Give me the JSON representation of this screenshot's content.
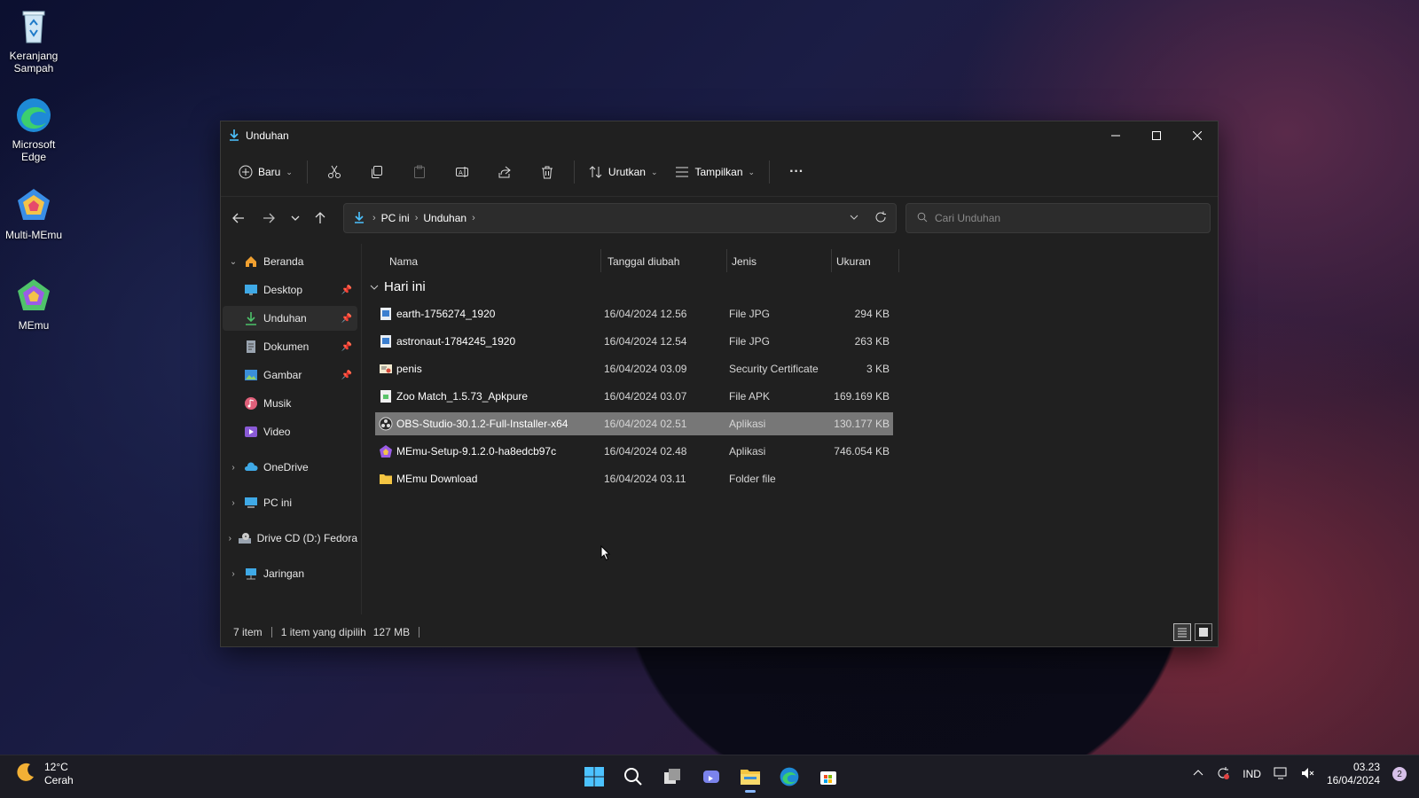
{
  "desktop": {
    "icons": [
      {
        "label": "Keranjang Sampah",
        "icon": "recycle-bin-icon"
      },
      {
        "label": "Microsoft Edge",
        "icon": "edge-icon"
      },
      {
        "label": "Multi-MEmu",
        "icon": "multi-memu-icon"
      },
      {
        "label": "MEmu",
        "icon": "memu-icon"
      }
    ]
  },
  "window": {
    "title": "Unduhan",
    "toolbar": {
      "new_label": "Baru",
      "sort_label": "Urutkan",
      "view_label": "Tampilkan",
      "more_label": "···"
    },
    "address": {
      "crumbs": [
        "PC ini",
        "Unduhan"
      ]
    },
    "search": {
      "placeholder": "Cari Unduhan"
    },
    "sidebar": {
      "items": [
        {
          "label": "Beranda",
          "icon": "home-icon"
        },
        {
          "label": "Desktop",
          "icon": "desktop-icon"
        },
        {
          "label": "Unduhan",
          "icon": "download-icon"
        },
        {
          "label": "Dokumen",
          "icon": "document-icon"
        },
        {
          "label": "Gambar",
          "icon": "picture-icon"
        },
        {
          "label": "Musik",
          "icon": "music-icon"
        },
        {
          "label": "Video",
          "icon": "video-icon"
        },
        {
          "label": "OneDrive",
          "icon": "cloud-icon"
        },
        {
          "label": "PC ini",
          "icon": "pc-icon"
        },
        {
          "label": "Drive CD (D:) Fedora",
          "icon": "cd-drive-icon"
        },
        {
          "label": "Jaringan",
          "icon": "network-icon"
        }
      ]
    },
    "columns": {
      "name": "Nama",
      "date": "Tanggal diubah",
      "type": "Jenis",
      "size": "Ukuran"
    },
    "group": "Hari ini",
    "files": [
      {
        "name": "earth-1756274_1920",
        "date": "16/04/2024 12.56",
        "type": "File JPG",
        "size": "294 KB",
        "icon": "image-file-icon"
      },
      {
        "name": "astronaut-1784245_1920",
        "date": "16/04/2024 12.54",
        "type": "File JPG",
        "size": "263 KB",
        "icon": "image-file-icon"
      },
      {
        "name": "penis",
        "date": "16/04/2024 03.09",
        "type": "Security Certificate",
        "size": "3 KB",
        "icon": "certificate-icon"
      },
      {
        "name": "Zoo Match_1.5.73_Apkpure",
        "date": "16/04/2024 03.07",
        "type": "File APK",
        "size": "169.169 KB",
        "icon": "apk-file-icon"
      },
      {
        "name": "OBS-Studio-30.1.2-Full-Installer-x64",
        "date": "16/04/2024 02.51",
        "type": "Aplikasi",
        "size": "130.177 KB",
        "icon": "obs-icon"
      },
      {
        "name": "MEmu-Setup-9.1.2.0-ha8edcb97c",
        "date": "16/04/2024 02.48",
        "type": "Aplikasi",
        "size": "746.054 KB",
        "icon": "memu-setup-icon"
      },
      {
        "name": "MEmu Download",
        "date": "16/04/2024 03.11",
        "type": "Folder file",
        "size": "",
        "icon": "folder-icon"
      }
    ],
    "status": {
      "count": "7 item",
      "selected": "1 item yang dipilih",
      "size": "127 MB"
    }
  },
  "taskbar": {
    "weather": {
      "temp": "12°C",
      "condition": "Cerah"
    },
    "lang": "IND",
    "time": "03.23",
    "date": "16/04/2024",
    "notifications": "2"
  },
  "colors": {
    "accent": "#4cc2ff",
    "selection": "#777777",
    "folder": "#f4c542"
  }
}
